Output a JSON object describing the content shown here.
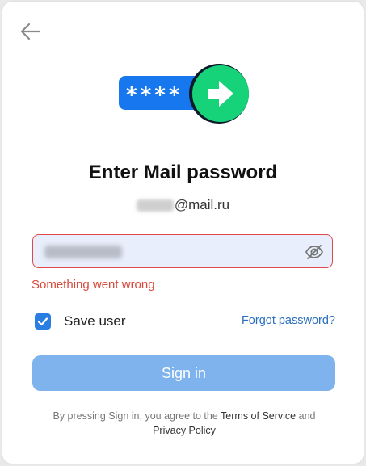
{
  "header": {
    "back_icon": "arrow-left-icon"
  },
  "hero": {
    "mask_text": "****",
    "arrow_icon": "arrow-right-icon",
    "colors": {
      "pill": "#1677ee",
      "circle": "#16d37a"
    }
  },
  "title": "Enter Mail password",
  "email": {
    "domain": "@mail.ru"
  },
  "password_field": {
    "toggle_icon": "eye-off-icon"
  },
  "error_text": "Something went wrong",
  "save_user": {
    "label": "Save user",
    "checked": true
  },
  "forgot_password": "Forgot password?",
  "signin_button": "Sign in",
  "legal": {
    "prefix": "By pressing Sign in, you agree to the ",
    "terms": "Terms of Service",
    "and": " and ",
    "privacy": "Privacy Policy"
  },
  "colors": {
    "accent": "#2a7de1",
    "error": "#d9483b",
    "button_disabled": "#7fb3ee"
  }
}
